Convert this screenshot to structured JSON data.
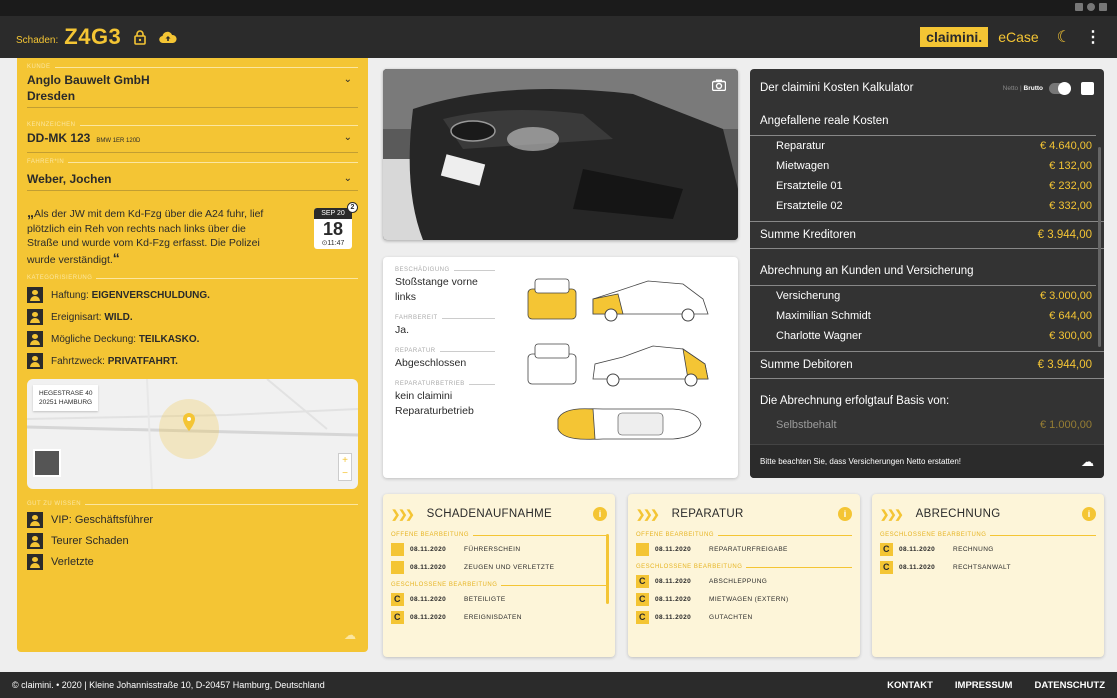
{
  "header": {
    "case_label": "Schaden:",
    "case_id": "Z4G3",
    "brand": "claimini.",
    "product": "eCase"
  },
  "left": {
    "kunde_label": "KUNDE",
    "kunde_name": "Anglo Bauwelt GmbH",
    "kunde_city": "Dresden",
    "kennzeichen_label": "KENNZEICHEN",
    "kennzeichen": "DD-MK 123",
    "vehicle": "BMW 1ER 120D",
    "fahrer_label": "FAHRER*IN",
    "fahrer": "Weber, Jochen",
    "quote_open": "„",
    "quote_text": "Als der JW mit dem Kd-Fzg über die A24 fuhr, lief plötzlich ein Reh von rechts nach links über die Straße und wurde vom Kd-Fzg erfasst. Die Polizei wurde verständigt.",
    "quote_close": "“",
    "calendar": {
      "month": "SEP 20",
      "day": "18",
      "time": "⊙11:47",
      "badge": "2"
    },
    "kategorisierung_label": "KATEGORISIERUNG",
    "categories": [
      {
        "key": "Haftung:",
        "value": "EIGENVERSCHULDUNG."
      },
      {
        "key": "Ereignisart:",
        "value": "WILD."
      },
      {
        "key": "Mögliche Deckung:",
        "value": "TEILKASKO."
      },
      {
        "key": "Fahrtzweck:",
        "value": "PRIVATFAHRT."
      }
    ],
    "map": {
      "address_line1": "HEGESTRASE 40",
      "address_line2": "20251 HAMBURG",
      "zoom_in": "+",
      "zoom_out": "−"
    },
    "gut_label": "GUT ZU WISSEN",
    "gut": [
      "VIP: Geschäftsführer",
      "Teurer Schaden",
      "Verletzte"
    ]
  },
  "damage": {
    "items": [
      {
        "label": "BESCHÄDIGUNG",
        "value": "Stoßstange vorne links"
      },
      {
        "label": "FAHRBEREIT",
        "value": "Ja."
      },
      {
        "label": "REPARATUR",
        "value": "Abgeschlossen"
      },
      {
        "label": "REPARATURBETRIEB",
        "value": "kein claimini Reparaturbetrieb"
      }
    ]
  },
  "calc": {
    "title": "Der claimini Kosten Kalkulator",
    "netto": "Netto",
    "brutto": "Brutto",
    "section1": "Angefallene reale Kosten",
    "rows1": [
      {
        "k": "Reparatur",
        "v": "€ 4.640,00"
      },
      {
        "k": "Mietwagen",
        "v": "€ 132,00"
      },
      {
        "k": "Ersatzteile 01",
        "v": "€ 232,00"
      },
      {
        "k": "Ersatzteile 02",
        "v": "€ 332,00"
      }
    ],
    "sum1": {
      "k": "Summe Kreditoren",
      "v": "€ 3.944,00"
    },
    "section2": "Abrechnung an Kunden und Versicherung",
    "rows2": [
      {
        "k": "Versicherung",
        "v": "€ 3.000,00"
      },
      {
        "k": "Maximilian Schmidt",
        "v": "€ 644,00"
      },
      {
        "k": "Charlotte Wagner",
        "v": "€ 300,00"
      }
    ],
    "sum2": {
      "k": "Summe Debitoren",
      "v": "€ 3.944,00"
    },
    "section3": "Die Abrechnung erfolgtauf Basis von:",
    "rows3": [
      {
        "k": "Selbstbehalt",
        "v": "€ 1.000,00"
      }
    ],
    "note": "Bitte beachten Sie, dass Versicherungen Netto erstatten!"
  },
  "workflow": [
    {
      "name": "SCHADENAUFNAHME",
      "groups": [
        {
          "label": "OFFENE BEARBEITUNG",
          "icon": "square",
          "items": [
            {
              "date": "08.11.2020",
              "text": "FÜHRERSCHEIN"
            },
            {
              "date": "08.11.2020",
              "text": "ZEUGEN UND VERLETZTE"
            }
          ]
        },
        {
          "label": "GESCHLOSSENE BEARBEITUNG",
          "icon": "C",
          "items": [
            {
              "date": "08.11.2020",
              "text": "BETEILIGTE"
            },
            {
              "date": "08.11.2020",
              "text": "EREIGNISDATEN"
            }
          ]
        }
      ]
    },
    {
      "name": "REPARATUR",
      "groups": [
        {
          "label": "OFFENE BEARBEITUNG",
          "icon": "square",
          "items": [
            {
              "date": "08.11.2020",
              "text": "REPARATURFREIGABE"
            }
          ]
        },
        {
          "label": "GESCHLOSSENE BEARBEITUNG",
          "icon": "C",
          "items": [
            {
              "date": "08.11.2020",
              "text": "ABSCHLEPPUNG"
            },
            {
              "date": "08.11.2020",
              "text": "MIETWAGEN (EXTERN)"
            },
            {
              "date": "08.11.2020",
              "text": "GUTACHTEN"
            }
          ]
        }
      ]
    },
    {
      "name": "ABRECHNUNG",
      "groups": [
        {
          "label": "GESCHLOSSENE BEARBEITUNG",
          "icon": "C",
          "items": [
            {
              "date": "08.11.2020",
              "text": "RECHNUNG"
            },
            {
              "date": "08.11.2020",
              "text": "RECHTSANWALT"
            }
          ]
        }
      ]
    }
  ],
  "footer": {
    "copyright": "© claimini. • 2020 | Kleine Johannisstraße 10, D-20457 Hamburg, Deutschland",
    "links": [
      "KONTAKT",
      "IMPRESSUM",
      "DATENSCHUTZ"
    ]
  },
  "colors": {
    "accent": "#f4c534",
    "dark": "#2b2b2b",
    "panel": "#333333"
  }
}
